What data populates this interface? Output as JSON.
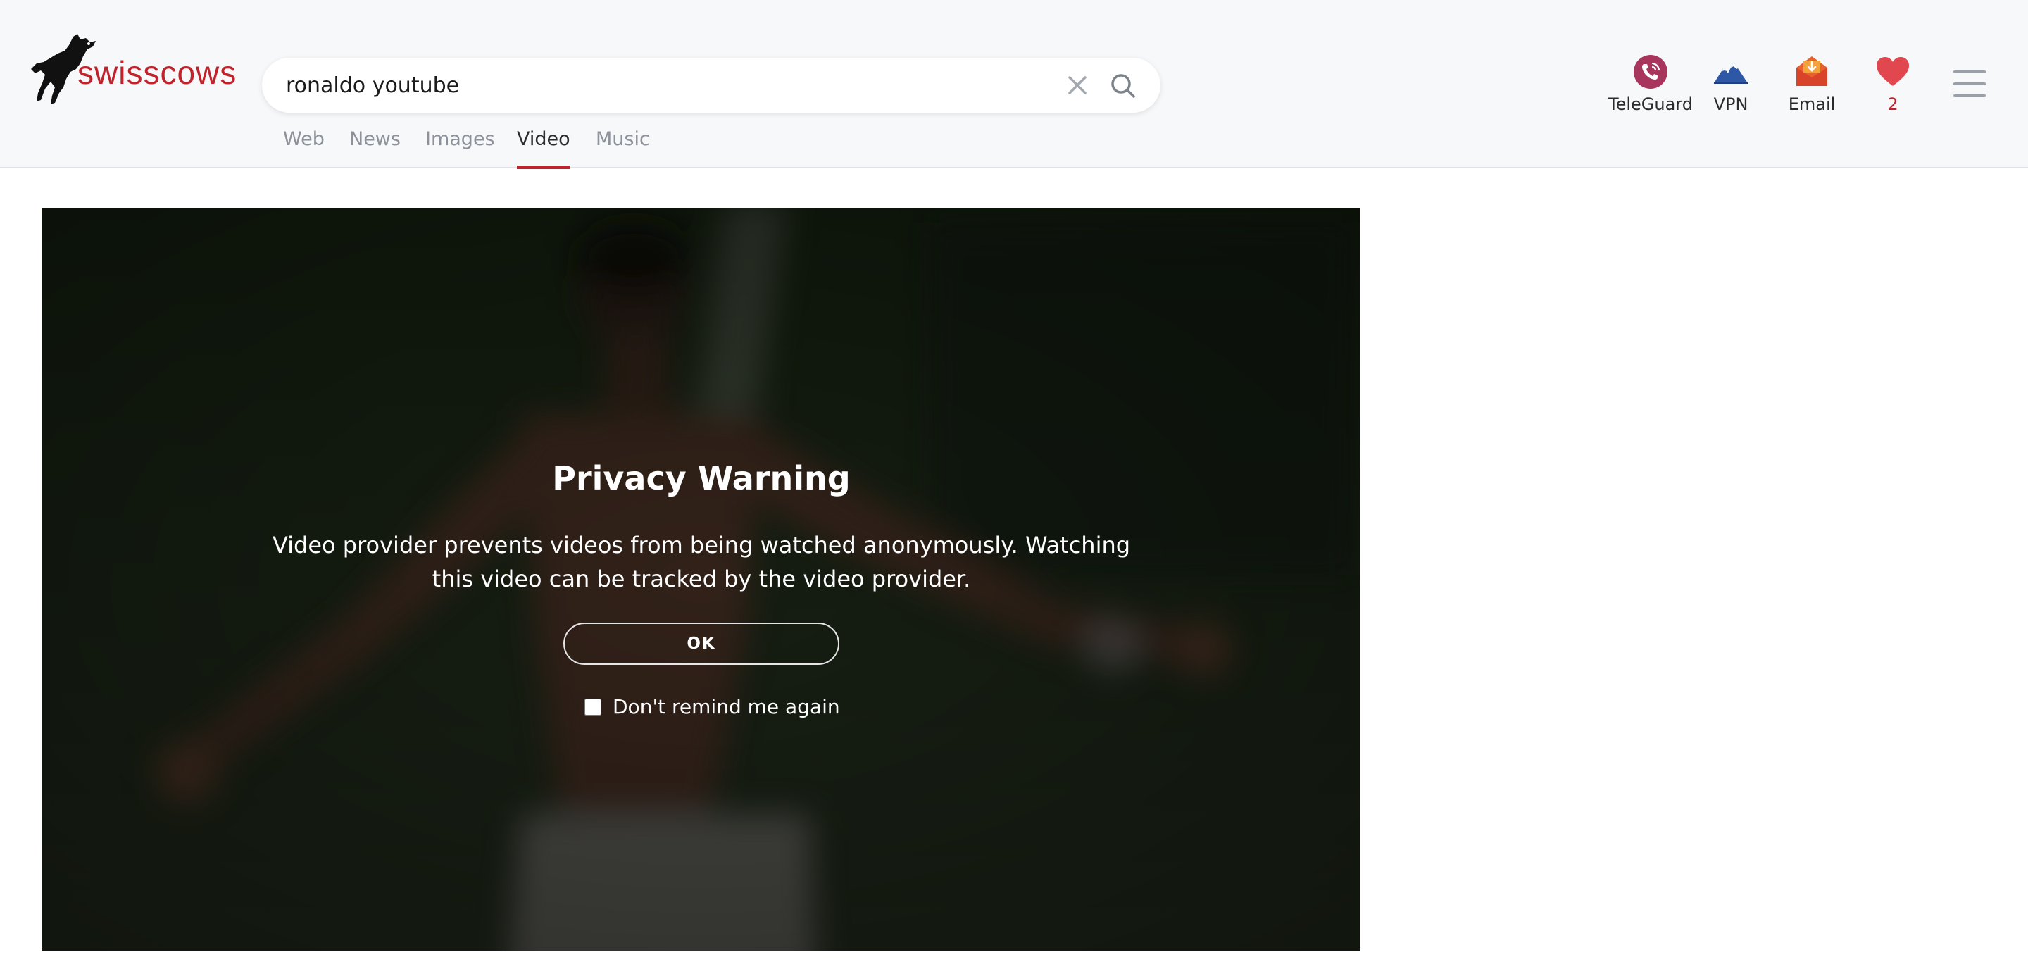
{
  "brand": {
    "name": "swisscows",
    "logo_icon": "cow-icon",
    "accent_color": "#c0232b"
  },
  "search": {
    "value": "ronaldo youtube",
    "clear_icon": "close-icon",
    "submit_icon": "search-icon"
  },
  "tabs": [
    {
      "label": "Web",
      "active": false
    },
    {
      "label": "News",
      "active": false
    },
    {
      "label": "Images",
      "active": false
    },
    {
      "label": "Video",
      "active": true
    },
    {
      "label": "Music",
      "active": false
    }
  ],
  "header_apps": [
    {
      "label": "TeleGuard",
      "icon": "teleguard-phone-icon"
    },
    {
      "label": "VPN",
      "icon": "vpn-mountain-icon"
    },
    {
      "label": "Email",
      "icon": "email-envelope-icon"
    },
    {
      "label": "2",
      "icon": "heart-icon"
    }
  ],
  "menu_icon": "hamburger-menu-icon",
  "privacy_warning": {
    "title": "Privacy Warning",
    "message": "Video provider prevents videos from being watched anonymously. Watching this video can be tracked by the video provider.",
    "ok_label": "OK",
    "checkbox_label": "Don't remind me again",
    "checkbox_checked": false
  }
}
